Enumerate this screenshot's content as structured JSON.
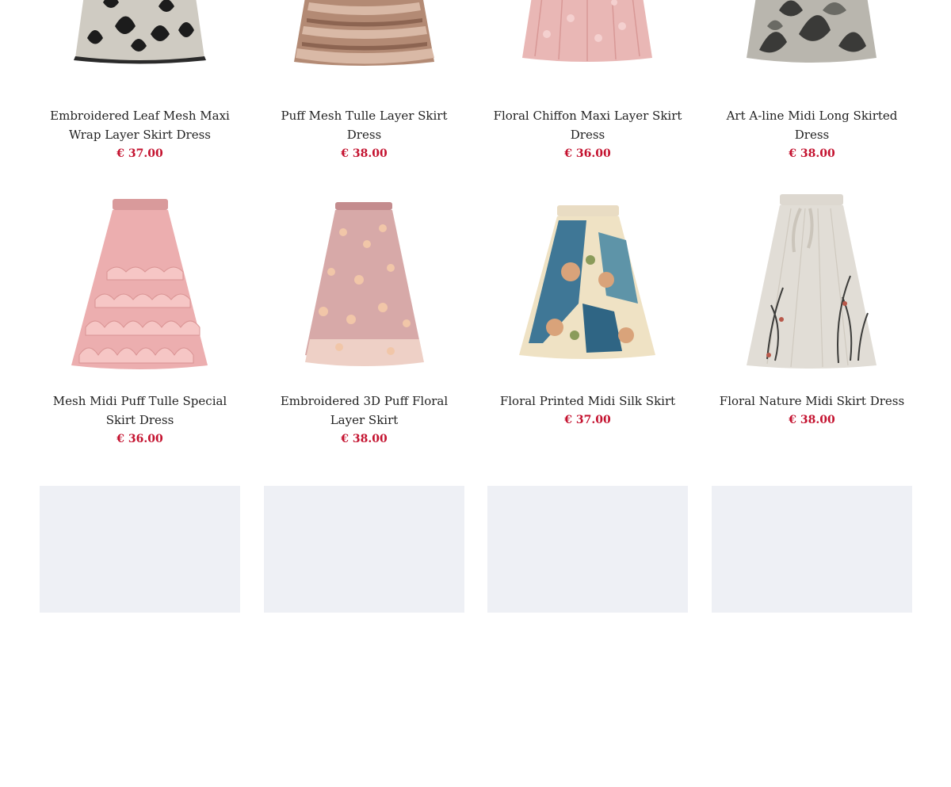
{
  "products": [
    {
      "title": "Embroidered Leaf Mesh Maxi Wrap Layer Skirt Dress",
      "price": "€ 37.00"
    },
    {
      "title": "Puff Mesh Tulle Layer Skirt Dress",
      "price": "€ 38.00"
    },
    {
      "title": "Floral Chiffon Maxi Layer Skirt Dress",
      "price": "€ 36.00"
    },
    {
      "title": "Art A-line Midi Long Skirted Dress",
      "price": "€ 38.00"
    },
    {
      "title": "Mesh Midi Puff Tulle Special Skirt Dress",
      "price": "€ 36.00"
    },
    {
      "title": "Embroidered 3D Puff Floral Layer Skirt",
      "price": "€ 38.00"
    },
    {
      "title": "Floral Printed Midi Silk Skirt",
      "price": "€ 37.00"
    },
    {
      "title": "Floral Nature Midi Skirt Dress",
      "price": "€ 38.00"
    }
  ],
  "colors": {
    "price": "#c4122f",
    "placeholder": "#eef0f5"
  }
}
